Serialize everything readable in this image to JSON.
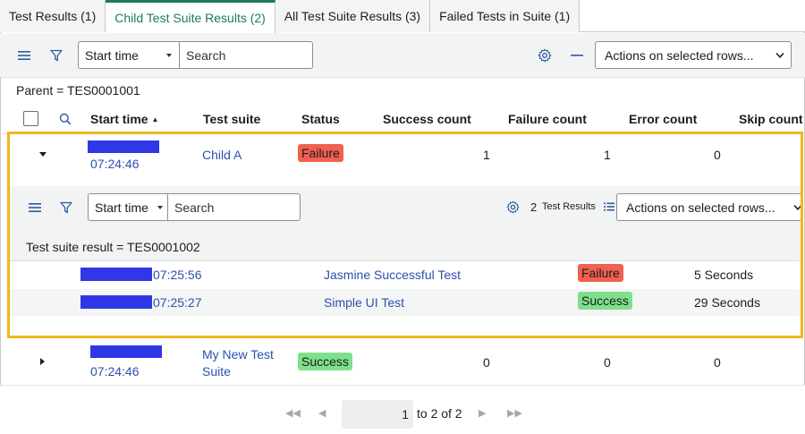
{
  "tabs": [
    {
      "label": "Test Results (1)"
    },
    {
      "label": "Child Test Suite Results (2)"
    },
    {
      "label": "All Test Suite Results (3)"
    },
    {
      "label": "Failed Tests in Suite (1)"
    }
  ],
  "toolbar": {
    "field_select": "Start time",
    "search_placeholder": "Search",
    "actions_select": "Actions on selected rows..."
  },
  "breadcrumb": "Parent = TES0001001",
  "columns": [
    "Start time",
    "Test suite",
    "Status",
    "Success count",
    "Failure count",
    "Error count",
    "Skip count"
  ],
  "rows": [
    {
      "time": "07:24:46",
      "suite": "Child A",
      "status": "Failure",
      "success": "1",
      "failure": "1",
      "error": "0"
    },
    {
      "time": "07:24:46",
      "suite_line1": "My New Test",
      "suite_line2": "Suite",
      "status": "Success",
      "success": "0",
      "failure": "0",
      "error": "0"
    }
  ],
  "nested": {
    "field_select": "Start time",
    "search_placeholder": "Search",
    "count": "2",
    "count_label": "Test Results",
    "actions_select": "Actions on selected rows...",
    "breadcrumb": "Test suite result = TES0001002",
    "rows": [
      {
        "time": "07:25:56",
        "test": "Jasmine Successful Test",
        "status": "Failure",
        "duration": "5 Seconds"
      },
      {
        "time": "07:25:27",
        "test": "Simple UI Test",
        "status": "Success",
        "duration": "29 Seconds"
      }
    ]
  },
  "pager": {
    "current": "1",
    "range_text": "to 2 of 2"
  },
  "colors": {
    "accent": "#1f7a57",
    "link": "#2d4fae",
    "failure": "#f16050",
    "success": "#7fe08b",
    "highlight": "#f1b81a",
    "redaction": "#2f38e6"
  }
}
